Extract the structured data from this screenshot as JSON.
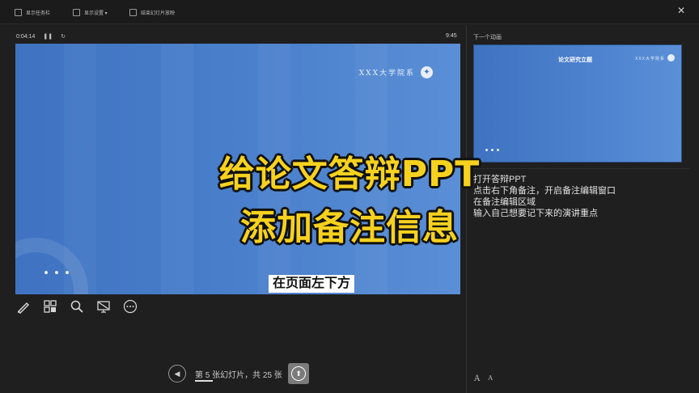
{
  "toolbar": {
    "items": [
      {
        "label": "显示任务栏",
        "icon": "taskbar-icon"
      },
      {
        "label": "显示设置 ▾",
        "icon": "display-settings-icon"
      },
      {
        "label": "结束幻灯片放映",
        "icon": "end-show-icon"
      }
    ],
    "close_icon": "close-icon"
  },
  "timer": {
    "elapsed": "0:04:14",
    "pause_icon": "pause-icon",
    "reset_icon": "reset-icon"
  },
  "clock": "9:45",
  "slide": {
    "header": "XXX大学院系"
  },
  "tools": [
    {
      "name": "pen-tool-icon"
    },
    {
      "name": "view-all-slides-icon"
    },
    {
      "name": "zoom-icon"
    },
    {
      "name": "black-screen-icon"
    },
    {
      "name": "more-options-icon"
    }
  ],
  "next_pane": {
    "label": "下一个动画",
    "thumb_title": "论文研究立题",
    "thumb_brand": "XXX大学院系"
  },
  "notes": [
    "打开答辩PPT",
    "点击右下角备注，开启备注编辑窗口",
    "在备注编辑区域",
    "输入自己想要记下来的演讲重点"
  ],
  "font_controls": {
    "increase": "A",
    "decrease": "A"
  },
  "navigation": {
    "status": "第 5 张幻灯片，共 25 张",
    "prev_icon": "previous-arrow-icon",
    "next_icon": "next-arrow-icon"
  },
  "captions": {
    "line1": "给论文答辩PPT",
    "line2": "添加备注信息",
    "subtitle": "在页面左下方"
  },
  "colors": {
    "slide_blue": "#4a80cc",
    "caption_yellow": "#f6d21f",
    "background": "#1f1f1f"
  }
}
